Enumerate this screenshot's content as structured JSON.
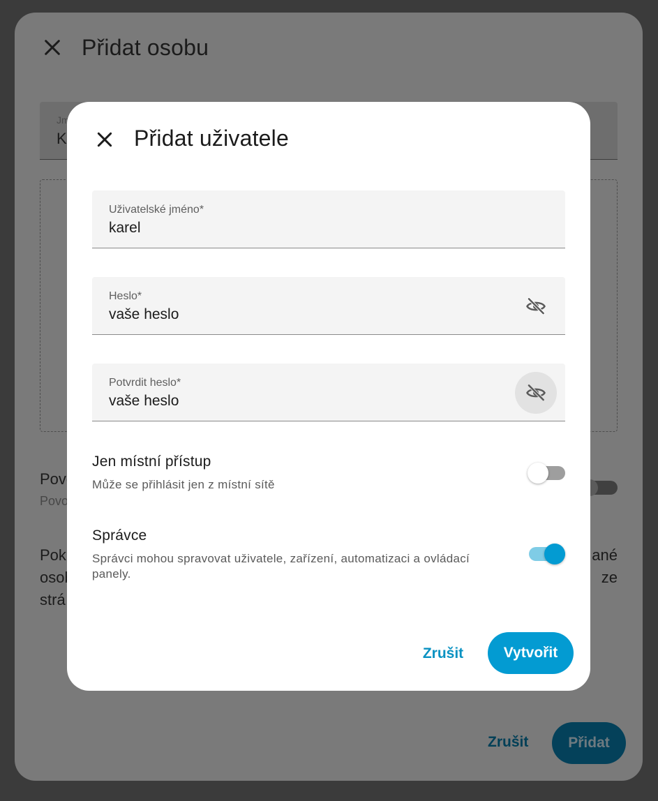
{
  "background_dialog": {
    "title": "Přidat osobu",
    "name_field": {
      "label": "Jm",
      "value": "K"
    },
    "allow_login": {
      "title": "Pove",
      "subtitle": "Povo"
    },
    "paragraph": {
      "line1_start": "Pok",
      "line1_end": "ané",
      "line2_start": "osob",
      "line2_end": "ze",
      "line3_start": "strá"
    },
    "cancel_label": "Zrušit",
    "add_label": "Přidat"
  },
  "dialog": {
    "title": "Přidat uživatele",
    "username": {
      "label": "Uživatelské jméno*",
      "value": "karel"
    },
    "password": {
      "label": "Heslo*",
      "value": "vaše heslo"
    },
    "confirm_password": {
      "label": "Potvrdit heslo*",
      "value": "vaše heslo"
    },
    "local_only": {
      "title": "Jen místní přístup",
      "subtitle": "Může se přihlásit jen z místní sítě",
      "enabled": false
    },
    "admin": {
      "title": "Správce",
      "subtitle": "Správci mohou spravovat uživatele, zařízení, automatizaci a ovládací panely.",
      "enabled": true
    },
    "cancel_label": "Zrušit",
    "create_label": "Vytvořit"
  },
  "colors": {
    "accent": "#039bd2",
    "accent_light": "#7fcce6",
    "scrim": "#3b3b3b"
  },
  "icons": {
    "close": "close-icon",
    "visibility_off": "eye-off-icon"
  }
}
